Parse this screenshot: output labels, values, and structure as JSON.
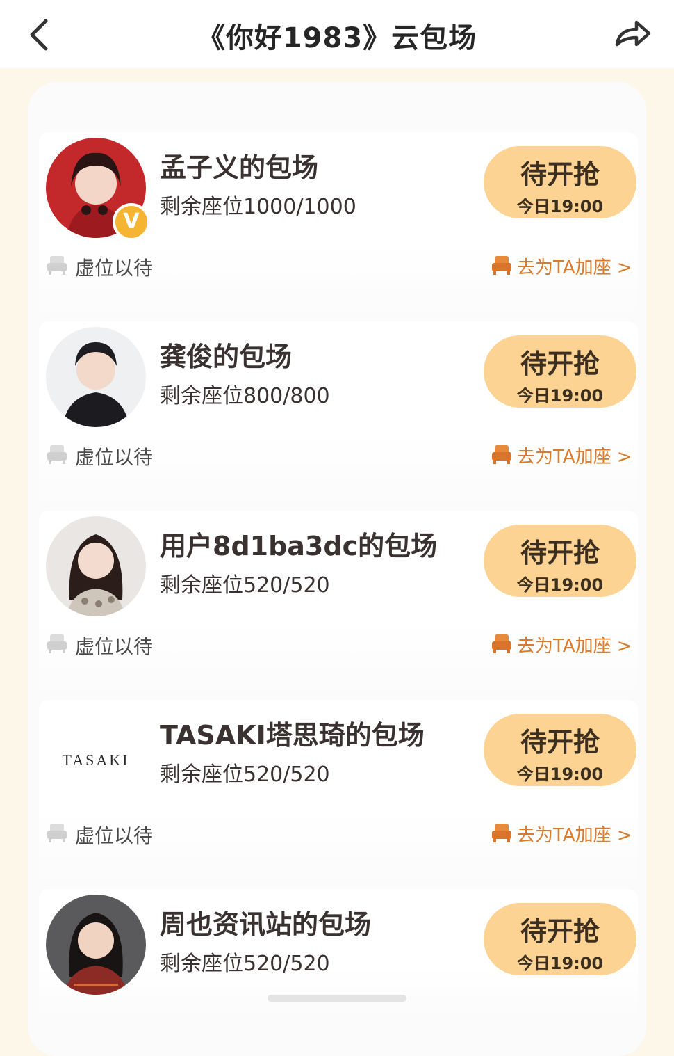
{
  "header": {
    "title": "《你好1983》云包场",
    "back_icon": "chevron-left-icon",
    "share_icon": "share-arrow-icon"
  },
  "colors": {
    "accent_button": "#fdd394",
    "add_seat_text": "#d97b2c",
    "title_text": "#3a3230",
    "page_bg": "#fdf7ea"
  },
  "cards": [
    {
      "title": "孟子义的包场",
      "seats": "剩余座位1000/1000",
      "button_label": "待开抢",
      "button_time": "今日19:00",
      "virtual_label": "虚位以待",
      "add_seat_label": "去为TA加座 >",
      "verified": true
    },
    {
      "title": "龚俊的包场",
      "seats": "剩余座位800/800",
      "button_label": "待开抢",
      "button_time": "今日19:00",
      "virtual_label": "虚位以待",
      "add_seat_label": "去为TA加座 >"
    },
    {
      "title": "用户8d1ba3dc的包场",
      "seats": "剩余座位520/520",
      "button_label": "待开抢",
      "button_time": "今日19:00",
      "virtual_label": "虚位以待",
      "add_seat_label": "去为TA加座 >"
    },
    {
      "title": "TASAKI塔思琦的包场",
      "seats": "剩余座位520/520",
      "button_label": "待开抢",
      "button_time": "今日19:00",
      "virtual_label": "虚位以待",
      "add_seat_label": "去为TA加座 >",
      "logo_text": "TASAKI"
    },
    {
      "title": "周也资讯站的包场",
      "seats": "剩余座位520/520",
      "button_label": "待开抢",
      "button_time": "今日19:00"
    }
  ]
}
